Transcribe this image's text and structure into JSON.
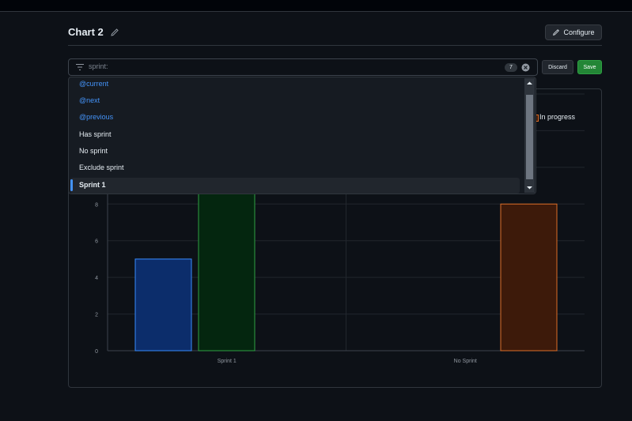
{
  "header": {
    "title": "Chart 2",
    "configure_label": "Configure"
  },
  "filter": {
    "query": "sprint:",
    "count": "7"
  },
  "actions": {
    "discard_label": "Discard",
    "save_label": "Save"
  },
  "dropdown": {
    "items": [
      {
        "label": "@current",
        "style": "link"
      },
      {
        "label": "@next",
        "style": "link"
      },
      {
        "label": "@previous",
        "style": "link"
      },
      {
        "label": "Has sprint",
        "style": "plain"
      },
      {
        "label": "No sprint",
        "style": "plain"
      },
      {
        "label": "Exclude sprint",
        "style": "plain"
      },
      {
        "label": "Sprint 1",
        "style": "selected"
      }
    ]
  },
  "legend": {
    "visible_item": "In progress"
  },
  "chart_data": {
    "type": "bar",
    "categories": [
      "Sprint 1",
      "No Sprint"
    ],
    "series": [
      {
        "values": [
          5,
          null
        ],
        "color": "#388bfd"
      },
      {
        "values": [
          14,
          null
        ],
        "color": "#2ea043"
      },
      {
        "name": "In progress",
        "values": [
          null,
          8
        ],
        "color": "#db6d28"
      }
    ],
    "y_ticks": [
      0,
      2,
      4,
      6,
      8
    ],
    "ylim": [
      0,
      14
    ],
    "grid": true
  },
  "colors": {
    "background": "#0d1117",
    "accent": "#4493f8",
    "save": "#238636"
  }
}
